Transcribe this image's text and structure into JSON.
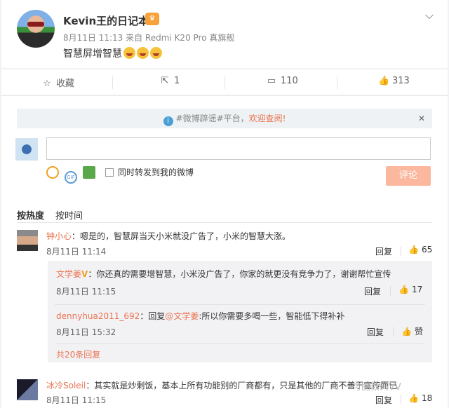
{
  "post": {
    "author": "Kevin王的日记本",
    "badge": "♛",
    "meta": "8月11日 11:13 来自 Redmi K20 Pro 真旗舰",
    "text": "智慧屏增智慧"
  },
  "actions": {
    "favorite": "收藏",
    "repost_count": "1",
    "comment_count": "110",
    "like_count": "313"
  },
  "notice": {
    "prefix": "#微博辟谣#平台，",
    "link": "欢迎查阅!",
    "close": "✕"
  },
  "composer": {
    "input_value": "",
    "repost_label": "同时转发到我的微博",
    "submit_label": "评论"
  },
  "sort": {
    "hot": "按热度",
    "time": "按时间"
  },
  "comments": [
    {
      "nick": "钟小心",
      "text": "：嗯是的，智慧屏当天小米就没广告了，小米的智慧大涨。",
      "time": "8月11日 11:14",
      "reply": "回复",
      "likes": "65"
    },
    {
      "nick": "冰冷Soleil",
      "text": "：其实就是炒剩饭，基本上所有功能别的厂商都有，只是其他的厂商不善于宣传而已",
      "time": "8月11日 11:15",
      "reply": "回复",
      "likes": "18"
    }
  ],
  "sub_replies": [
    {
      "nick": "文学姜",
      "badge": "V",
      "text": "：你还真的需要增智慧，小米没广告了，你家的就更没有竞争力了，谢谢帮忙宣传",
      "time": "8月11日 11:15",
      "reply": "回复",
      "likes": "17"
    },
    {
      "nick": "dennyhua2011_692",
      "text_prefix": "：回复",
      "mention": "@文学姜",
      "text": ":所以你需要多喝一些，智能低下得补补",
      "time": "8月11日 15:32",
      "reply": "回复",
      "likes": "赞"
    }
  ],
  "more_replies": "共20条回复",
  "watermark": "可圈数码VV"
}
